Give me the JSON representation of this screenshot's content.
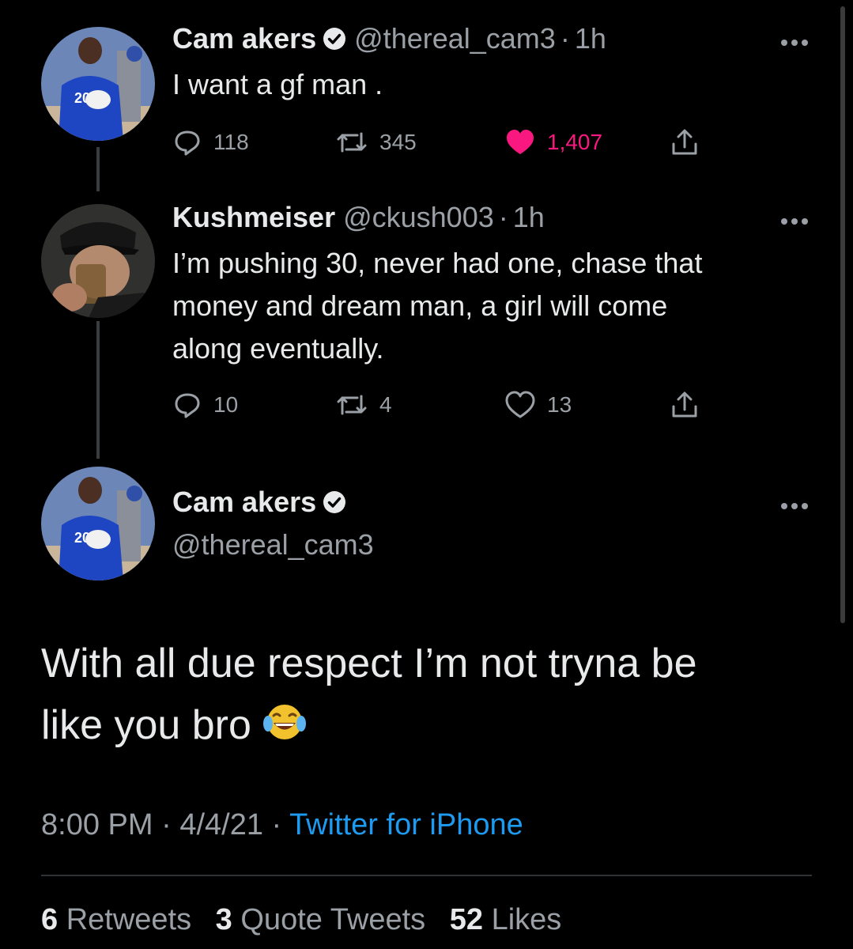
{
  "thread": [
    {
      "display_name": "Cam akers",
      "handle": "@thereal_cam3",
      "time": "1h",
      "text": "I want a gf man .",
      "replies": "118",
      "retweets": "345",
      "likes": "1,407",
      "liked": true,
      "verified": true,
      "avatar_icon": "football-player-avatar"
    },
    {
      "display_name": "Kushmeiser",
      "handle": "@ckush003",
      "time": "1h",
      "text_lines": [
        "I’m pushing 30, never had one, chase that",
        "money and dream man, a girl will come",
        "along eventually."
      ],
      "replies": "10",
      "retweets": "4",
      "likes": "13",
      "liked": false,
      "verified": false,
      "avatar_icon": "man-drinking-avatar"
    }
  ],
  "main_tweet": {
    "display_name": "Cam akers",
    "handle": "@thereal_cam3",
    "verified": true,
    "text_line1": "With all due respect I’m not tryna be",
    "text_line2": "like you bro",
    "emoji": "face-with-tears-of-joy",
    "time": "8:00 PM",
    "date": "4/4/21",
    "source": "Twitter for iPhone",
    "retweets_count": "6",
    "retweets_label": "Retweets",
    "quotes_count": "3",
    "quotes_label": "Quote Tweets",
    "likes_count": "52",
    "likes_label": "Likes"
  },
  "colors": {
    "background": "#000000",
    "text": "#e7e9ea",
    "secondary": "#9aa0a6",
    "link": "#1d9bf0",
    "like": "#f91880",
    "thread_line": "#3a3d40"
  }
}
